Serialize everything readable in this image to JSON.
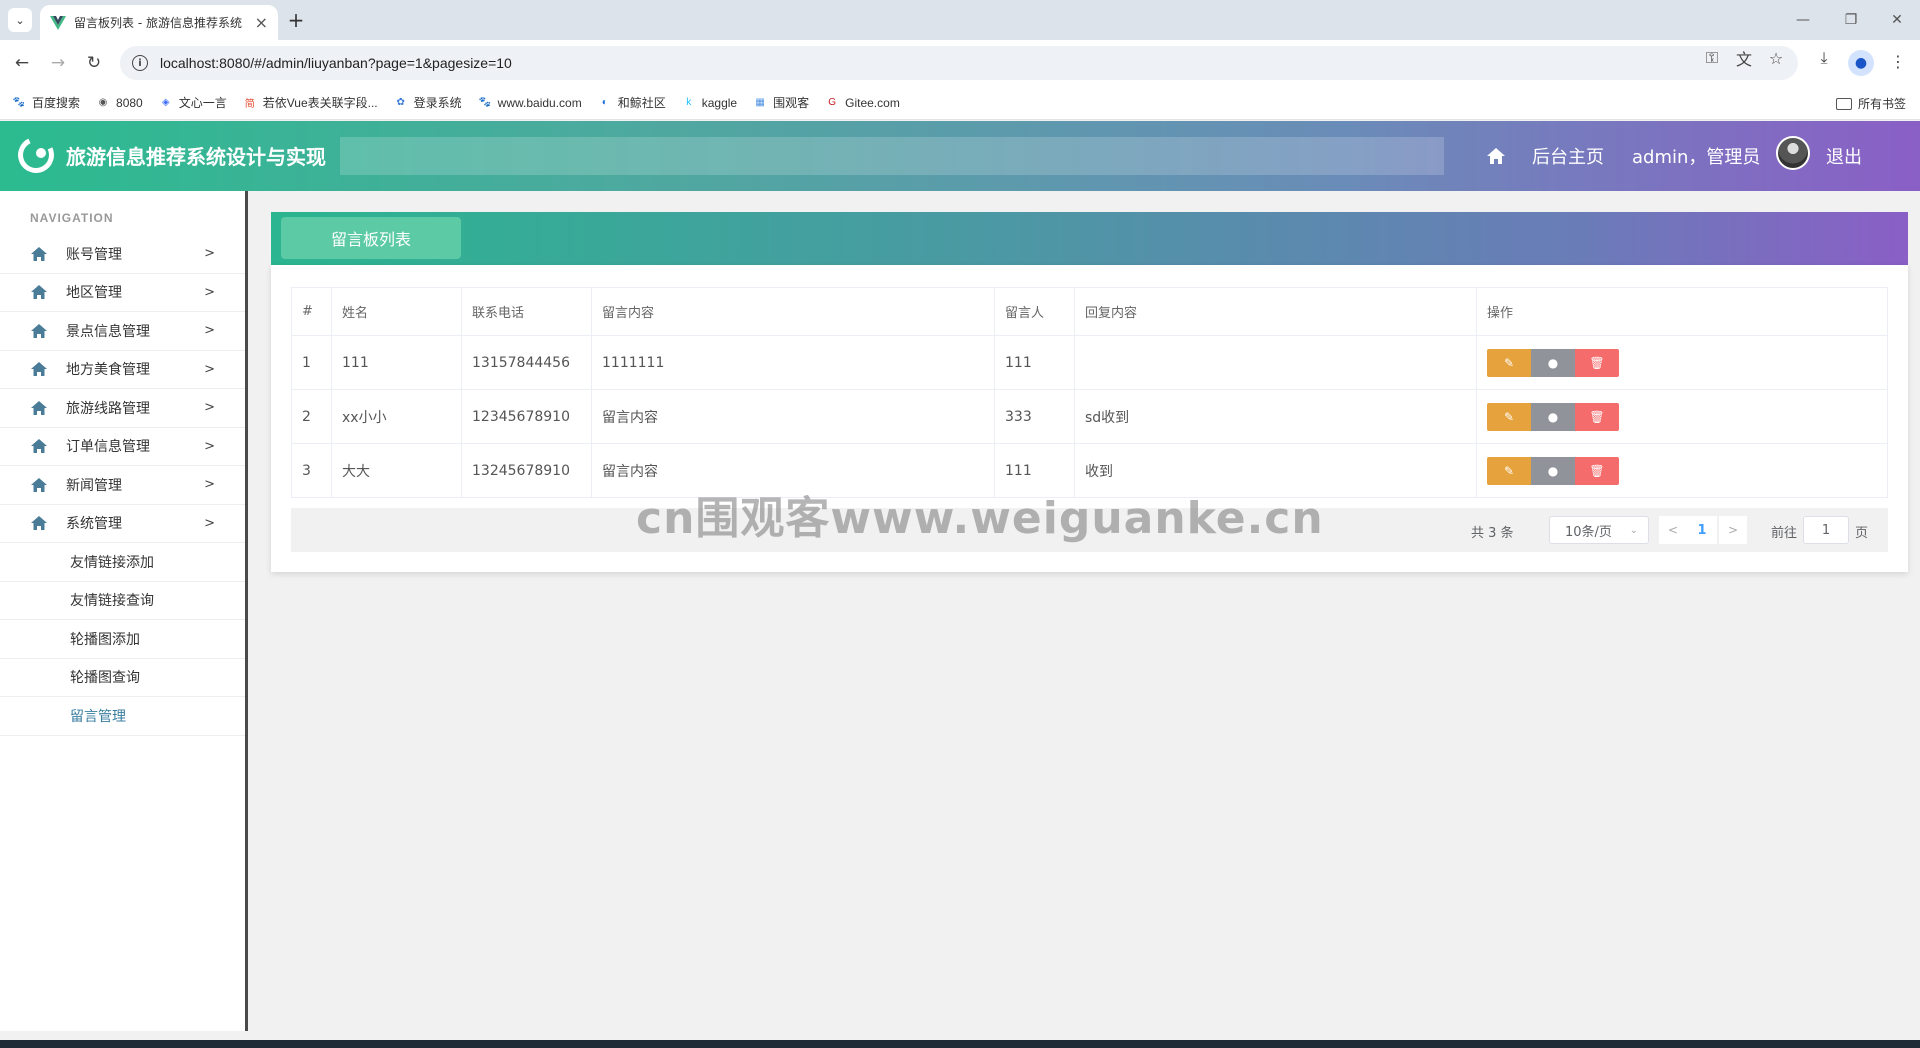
{
  "browser": {
    "tab_title": "留言板列表 - 旅游信息推荐系统",
    "url": "localhost:8080/#/admin/liuyanban?page=1&pagesize=10",
    "bookmarks": [
      {
        "label": "百度搜索",
        "icon": "baidu-paw-icon",
        "color": "#2f5fd8"
      },
      {
        "label": "8080",
        "icon": "globe-icon",
        "color": "#555555"
      },
      {
        "label": "文心一言",
        "icon": "wenxin-icon",
        "color": "#3b6cf6"
      },
      {
        "label": "若依Vue表关联字段...",
        "icon": "csdn-icon",
        "color": "#e0452a"
      },
      {
        "label": "登录系统",
        "icon": "lotus-icon",
        "color": "#3b7bd8"
      },
      {
        "label": "www.baidu.com",
        "icon": "baidu-paw-icon",
        "color": "#2f5fd8"
      },
      {
        "label": "和鲸社区",
        "icon": "heywhale-icon",
        "color": "#1e6fe0"
      },
      {
        "label": "kaggle",
        "icon": "kaggle-icon",
        "color": "#20beff"
      },
      {
        "label": "围观客",
        "icon": "weiguanke-icon",
        "color": "#4a90e2"
      },
      {
        "label": "Gitee.com",
        "icon": "gitee-icon",
        "color": "#c71d23"
      }
    ],
    "all_bookmarks": "所有书签"
  },
  "header": {
    "title": "旅游信息推荐系统设计与实现",
    "home_link": "后台主页",
    "user": "admin，管理员",
    "logout": "退出"
  },
  "sidebar": {
    "nav_title": "NAVIGATION",
    "items": [
      {
        "label": "账号管理"
      },
      {
        "label": "地区管理"
      },
      {
        "label": "景点信息管理"
      },
      {
        "label": "地方美食管理"
      },
      {
        "label": "旅游线路管理"
      },
      {
        "label": "订单信息管理"
      },
      {
        "label": "新闻管理"
      },
      {
        "label": "系统管理"
      }
    ],
    "sub_items": [
      {
        "label": "友情链接添加"
      },
      {
        "label": "友情链接查询"
      },
      {
        "label": "轮播图添加"
      },
      {
        "label": "轮播图查询"
      },
      {
        "label": "留言管理"
      }
    ]
  },
  "panel": {
    "tab_label": "留言板列表"
  },
  "table": {
    "columns": [
      "#",
      "姓名",
      "联系电话",
      "留言内容",
      "留言人",
      "回复内容",
      "操作"
    ],
    "rows": [
      [
        "1",
        "111",
        "13157844456",
        "1111111",
        "111",
        ""
      ],
      [
        "2",
        "xx小小",
        "12345678910",
        "留言内容",
        "333",
        "sd收到"
      ],
      [
        "3",
        "大大",
        "13245678910",
        "留言内容",
        "111",
        "收到"
      ]
    ]
  },
  "pagination": {
    "total": "共 3 条",
    "page_size": "10条/页",
    "current_page": "1",
    "goto_label": "前往",
    "goto_value": "1",
    "page_unit": "页"
  },
  "watermark": "cn围观客www.weiguanke.cn",
  "colors": {
    "edit": "#e6a23c",
    "info": "#909399",
    "delete": "#f56c6c",
    "header_start": "#2bbb8f",
    "header_end": "#8a5fc6",
    "active_sub": "#3a7ea0"
  }
}
